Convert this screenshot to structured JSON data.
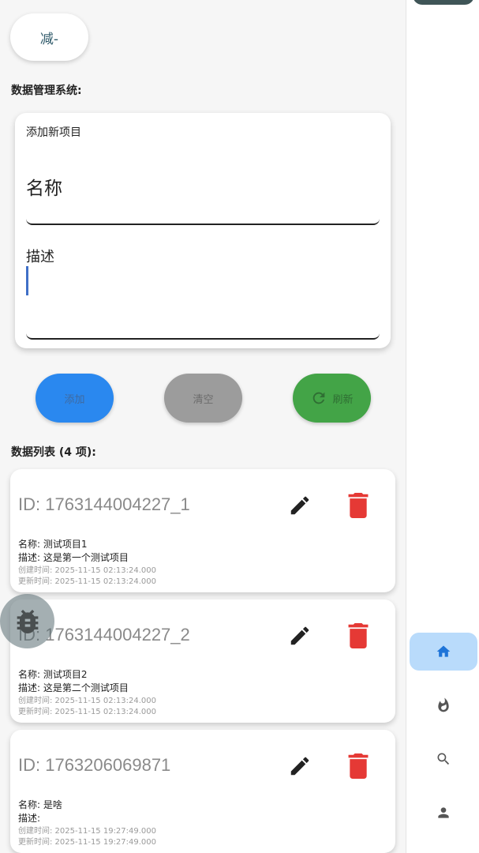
{
  "decrement_button": {
    "label": "减-"
  },
  "system": {
    "title": "数据管理系统:"
  },
  "form": {
    "heading": "添加新项目",
    "name_placeholder": "名称",
    "desc_placeholder": "描述"
  },
  "actions": {
    "add_label": "添加",
    "clear_label": "清空",
    "refresh_label": "刷新"
  },
  "list": {
    "title": "数据列表 (4 项):",
    "items": [
      {
        "id": "ID: 1763144004227_1",
        "name": "名称: 测试项目1",
        "desc": "描述: 这是第一个测试项目",
        "created": "创建时间: 2025-11-15 02:13:24.000",
        "updated": "更新时间: 2025-11-15 02:13:24.000"
      },
      {
        "id": "ID: 1763144004227_2",
        "name": "名称: 测试项目2",
        "desc": "描述: 这是第二个测试项目",
        "created": "创建时间: 2025-11-15 02:13:24.000",
        "updated": "更新时间: 2025-11-15 02:13:24.000"
      },
      {
        "id": "ID: 1763206069871",
        "name": "名称: 是啥",
        "desc": "描述:",
        "created": "创建时间: 2025-11-15 19:27:49.000",
        "updated": "更新时间: 2025-11-15 19:27:49.000"
      }
    ]
  },
  "icons": {
    "edit": "edit-icon",
    "delete": "delete-icon",
    "refresh": "refresh-icon",
    "debug": "bug-icon",
    "nav": [
      "home-icon",
      "fire-icon",
      "search-icon",
      "person-icon"
    ]
  },
  "colors": {
    "add": "#2a88ef",
    "clear": "#9c9c9c",
    "refresh": "#43a447",
    "delete": "#e53935",
    "nav_active_bg": "#b9dbfb",
    "nav_active_icon": "#1e74d8"
  }
}
